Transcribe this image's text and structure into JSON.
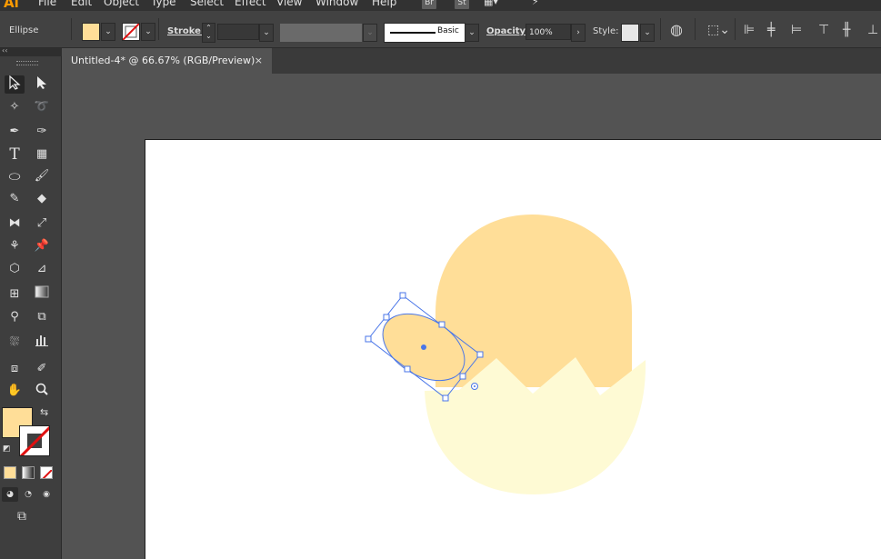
{
  "app": {
    "logo": "Ai"
  },
  "menu": [
    "File",
    "Edit",
    "Object",
    "Type",
    "Select",
    "Effect",
    "View",
    "Window",
    "Help"
  ],
  "menu_badges": [
    "Br",
    "St"
  ],
  "control_bar": {
    "selection_type": "Ellipse",
    "stroke_label": "Stroke:",
    "brush_label": "Basic",
    "opacity_label": "Opacity:",
    "opacity_value": "100%",
    "style_label": "Style:"
  },
  "document_tab": {
    "title": "Untitled-4* @ 66.67% (RGB/Preview)",
    "close": "×"
  },
  "colors": {
    "fill": "#ffde98",
    "egg_top": "#ffde98",
    "egg_shell": "#fefad4",
    "selection": "#4a76e8",
    "artboard": "#ffffff"
  },
  "toolbox": {
    "icons": [
      "selection-tool",
      "direct-selection-tool",
      "magic-wand-tool",
      "lasso-tool",
      "pen-tool",
      "curvature-tool",
      "type-tool",
      "grid-tool",
      "ellipse-tool",
      "paintbrush-tool",
      "shaper-tool",
      "eraser-tool",
      "rotate-tool",
      "scale-tool",
      "puppet-warp-tool",
      "pin-tool",
      "free-transform-tool",
      "perspective-tool",
      "mesh-tool",
      "gradient-tool",
      "eyedropper-tool",
      "blend-tool",
      "symbol-sprayer-tool",
      "graph-tool",
      "artboard-tool",
      "slice-tool",
      "hand-tool",
      "zoom-tool"
    ]
  }
}
